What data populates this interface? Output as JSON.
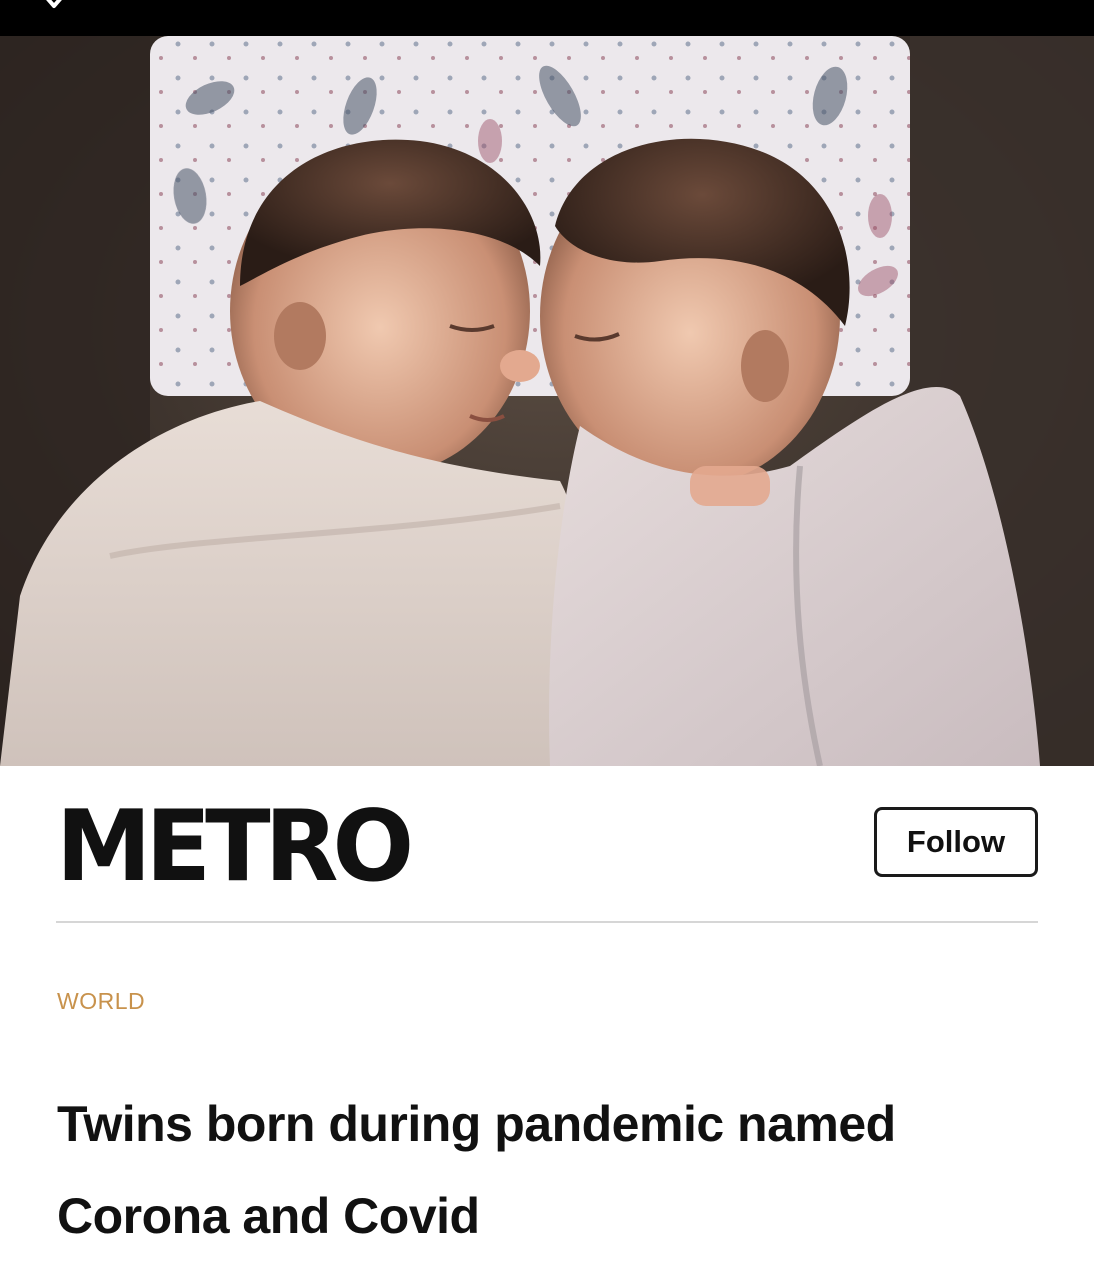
{
  "status_bar": {
    "back_icon": "chevron-down-icon",
    "background": "#000000"
  },
  "hero_image": {
    "subject": "newborn-twins-photo"
  },
  "publisher": {
    "name": "METRO",
    "follow_label": "Follow"
  },
  "article": {
    "category": "WORLD",
    "headline": "Twins born during pandemic named Corona and Covid"
  },
  "colors": {
    "category": "#c8924c",
    "text": "#111111",
    "divider": "#d6d6d6"
  }
}
